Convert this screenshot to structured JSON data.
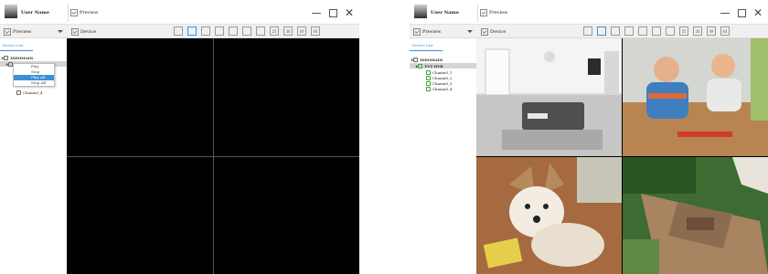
{
  "left_window": {
    "title_bar": {
      "user_name": "User Name",
      "tab_label": "Preview"
    },
    "toolbar": {
      "preview_label": "Preview",
      "device_label": "Device",
      "layout_labels": [
        "25",
        "36",
        "49",
        "64"
      ]
    },
    "sidebar": {
      "tab_label": "Device List",
      "tree": {
        "domain": "IXDOMAIN",
        "device": "TVT DVR",
        "channels": [
          "Channel_1",
          "Channel_2",
          "Channel_3",
          "Channel_4"
        ]
      },
      "context_menu": {
        "items": [
          "Play",
          "Stop",
          "Play All",
          "Stop All"
        ],
        "highlighted": "Play All"
      }
    },
    "video_grid": {
      "cells": 4,
      "state": "black"
    }
  },
  "right_window": {
    "title_bar": {
      "user_name": "User Name",
      "tab_label": "Preview"
    },
    "toolbar": {
      "preview_label": "Preview",
      "device_label": "Device",
      "layout_labels": [
        "25",
        "36",
        "49",
        "64"
      ]
    },
    "sidebar": {
      "tab_label": "Device List",
      "tree": {
        "domain": "IXDOMAIN",
        "device": "TVT DVR",
        "channels": [
          "Channel_1",
          "Channel_2",
          "Channel_3",
          "Channel_4"
        ]
      }
    },
    "video_grid": {
      "cells": 4,
      "feeds": [
        "living room",
        "children playing",
        "dog",
        "garden deck"
      ]
    }
  },
  "colors": {
    "accent": "#3d8fd9",
    "selection": "#d5d5d5",
    "channel_icon_online": "#3ba33b",
    "toolbar_bg": "#f0f0f0"
  }
}
